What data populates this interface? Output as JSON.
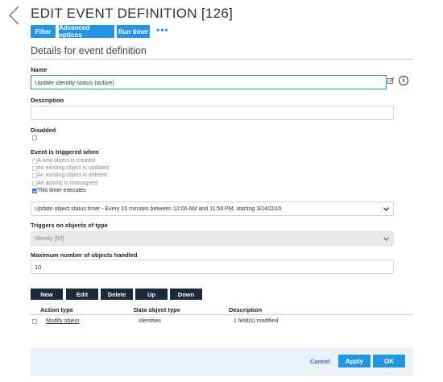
{
  "header": {
    "title": "EDIT EVENT DEFINITION [126]"
  },
  "toolbar": {
    "filter": "Filter",
    "advanced_options": "Advanced options",
    "run_timer": "Run timer",
    "more": "•••"
  },
  "section": {
    "title": "Details for event definition"
  },
  "form": {
    "name_label": "Name",
    "name_value": "Update identity status (active)",
    "description_label": "Description",
    "description_value": "",
    "disabled_label": "Disabled",
    "disabled_checked": false,
    "trigger_label": "Event is triggered when",
    "trigger_options": [
      {
        "label": "A new object is created",
        "checked": false
      },
      {
        "label": "An existing object is updated",
        "checked": false
      },
      {
        "label": "An existing object is deleted",
        "checked": false
      },
      {
        "label": "An activity is reassigned",
        "checked": false
      },
      {
        "label": "This timer executes",
        "checked": true
      }
    ],
    "timer_select": "Update object status timer - Every 15 minutes between 12:00 AM and 11:59 PM, starting 3/24/2015",
    "object_type_label": "Triggers on objects of type",
    "object_type_value": "Identity [50]",
    "max_objects_label": "Maximum number of objects handled",
    "max_objects_value": "10"
  },
  "actions": {
    "new": "New",
    "edit": "Edit",
    "delete": "Delete",
    "up": "Up",
    "down": "Down"
  },
  "table": {
    "headers": [
      "Action type",
      "Data object type",
      "Description"
    ],
    "rows": [
      {
        "action_type": "Modify object",
        "data_object_type": "Identities",
        "description": "1 field(s) modified"
      }
    ]
  },
  "footer": {
    "cancel": "Cancel",
    "apply": "Apply",
    "ok": "OK"
  },
  "colors": {
    "primary": "#2196e8",
    "dark_button": "#1b2a3a",
    "footer_bg": "#eaf1f8"
  }
}
